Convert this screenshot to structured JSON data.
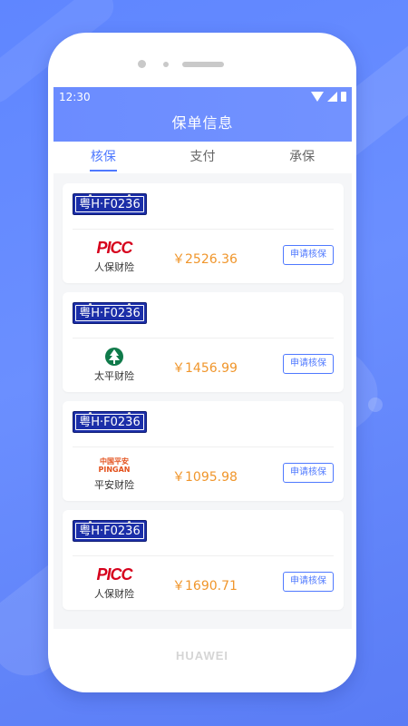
{
  "status_bar": {
    "time": "12:30"
  },
  "app": {
    "title": "保单信息"
  },
  "tabs": [
    {
      "label": "核保",
      "active": true
    },
    {
      "label": "支付",
      "active": false
    },
    {
      "label": "承保",
      "active": false
    }
  ],
  "policies": [
    {
      "plate": "粤H·F0236",
      "insurer": "人保财险",
      "logo": "picc",
      "logo_text": "PICC",
      "price": "￥2526.36",
      "action": "申请核保"
    },
    {
      "plate": "粤H·F0236",
      "insurer": "太平财险",
      "logo": "taiping",
      "logo_text": "",
      "price": "￥1456.99",
      "action": "申请核保"
    },
    {
      "plate": "粤H·F0236",
      "insurer": "平安财险",
      "logo": "pingan",
      "logo_text": "中国平安\nPINGAN",
      "price": "￥1095.98",
      "action": "申请核保"
    },
    {
      "plate": "粤H·F0236",
      "insurer": "人保财险",
      "logo": "picc",
      "logo_text": "PICC",
      "price": "￥1690.71",
      "action": "申请核保"
    }
  ],
  "device": {
    "brand": "HUAWEI"
  },
  "colors": {
    "primary": "#4f79ff",
    "header": "#6b8cff",
    "price": "#f0962c",
    "plate": "#1b2ea8"
  }
}
